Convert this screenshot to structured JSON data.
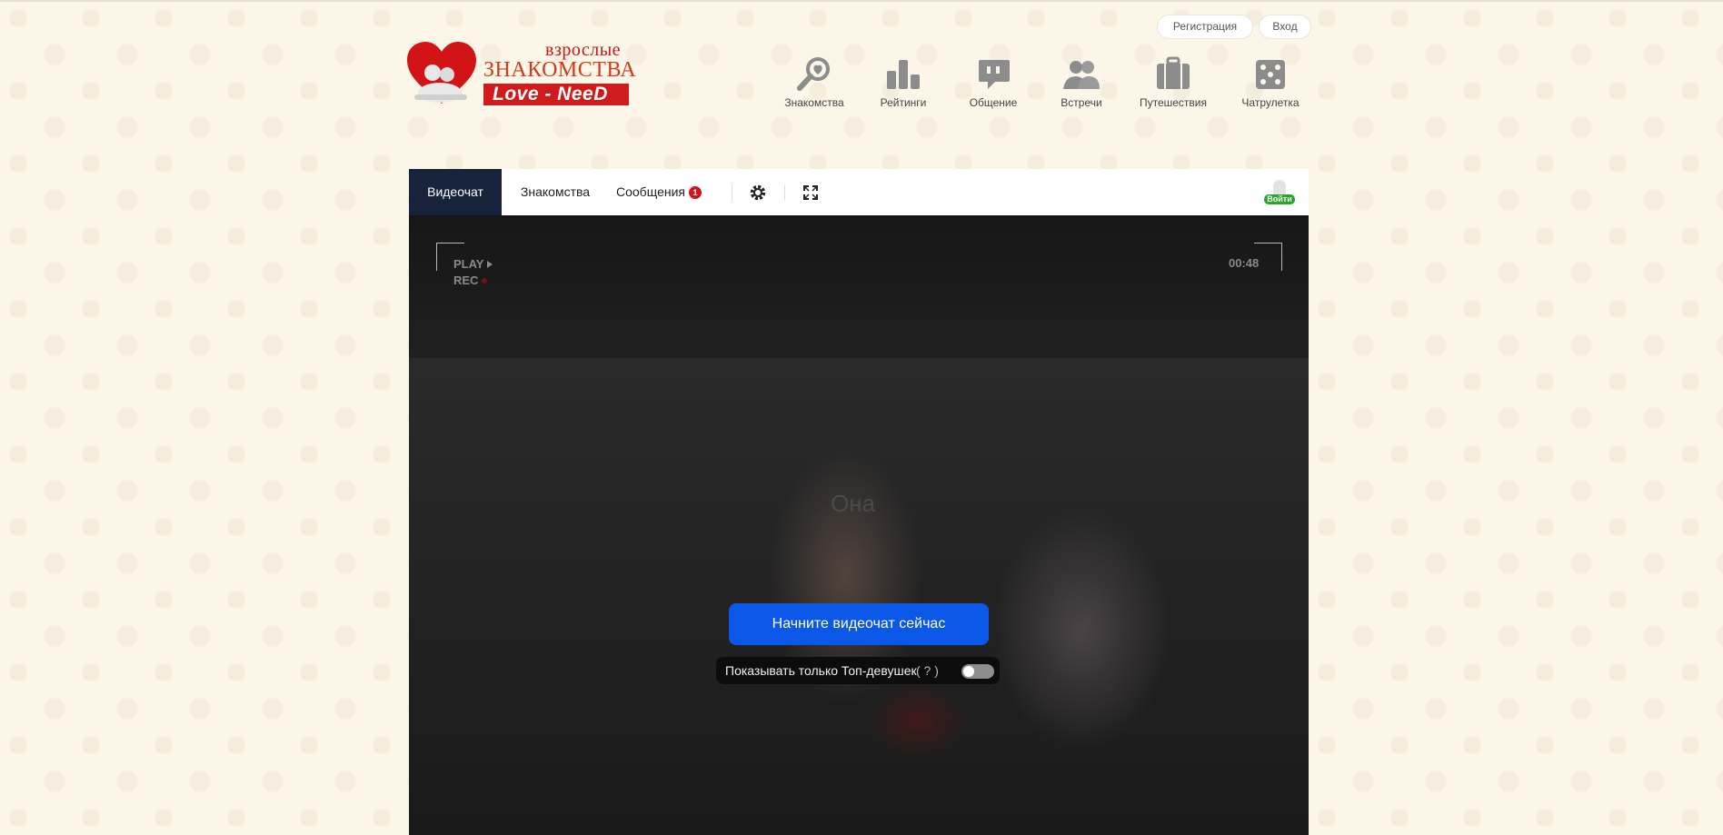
{
  "header": {
    "logo": {
      "line1": "взрослые",
      "line2": "ЗНАКОМСТВА",
      "line3": "Love - NeeD"
    },
    "auth": {
      "register": "Регистрация",
      "login": "Вход"
    },
    "nav": [
      {
        "label": "Знакомства",
        "icon": "search-heart-icon"
      },
      {
        "label": "Рейтинги",
        "icon": "bar-chart-icon"
      },
      {
        "label": "Общение",
        "icon": "chat-bubble-icon"
      },
      {
        "label": "Встречи",
        "icon": "people-icon"
      },
      {
        "label": "Путешествия",
        "icon": "suitcase-icon"
      },
      {
        "label": "Чатрулетка",
        "icon": "dice-icon"
      }
    ]
  },
  "chat": {
    "tabs": {
      "video": "Видеочат",
      "dating": "Знакомства",
      "messages": "Сообщения",
      "messages_count": "1"
    },
    "icons": [
      "gear-icon",
      "fullscreen-icon"
    ],
    "mini_login": "Войти",
    "video": {
      "play": "PLAY",
      "rec": "REC",
      "time": "00:48",
      "she_label": "Она",
      "start_button": "Начните видеочат сейчас",
      "top_only_label": "Показывать только Топ-девушек",
      "help": "( ? )",
      "top_only_enabled": false
    }
  },
  "colors": {
    "accent": "#0b57e8",
    "brand_red": "#cf1b1b",
    "tab_active_bg": "#17233a",
    "badge": "#d0141a",
    "login_green": "#2aa52a"
  }
}
